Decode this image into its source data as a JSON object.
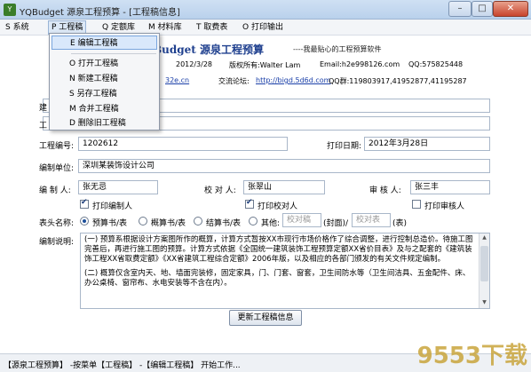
{
  "window": {
    "title": "YQBudget 源泉工程预算 - [工程稿信息]",
    "minimize_glyph": "–",
    "maximize_glyph": "□",
    "close_glyph": "✕"
  },
  "menubar": {
    "system": "S 系统",
    "project": "P 工程稿",
    "quota": "Q 定额库",
    "material": "M 材料库",
    "tables": "T 取费表",
    "print": "O 打印输出"
  },
  "dropdown": {
    "edit": "E 编辑工程稿",
    "open": "O 打开工程稿",
    "new": "N 新建工程稿",
    "saveas": "S 另存工程稿",
    "merge": "M 合并工程稿",
    "delete": "D 删除旧工程稿"
  },
  "banner": {
    "line1_name": "Budget  源泉工程预算",
    "line1_slogan": "----我最贴心的工程预算软件",
    "line2_date": "2012/3/28",
    "line2_copyright": "版权所有:Walter Lam",
    "line2_email": "Email:h2e998126.com",
    "line2_qq": "QQ:575825448",
    "line3_site": "32e.cn",
    "line3_forum_label": "交流论坛:",
    "line3_forum_url": "http://bigd.5d6d.com",
    "line3_qqgroup": "QQ群:119803917,41952877,41195287"
  },
  "form": {
    "project_no_label": "工程编号:",
    "project_no": "1202612",
    "print_date_label": "打印日期:",
    "print_date": "2012年3月28日",
    "unit_label": "编制单位:",
    "unit": "深圳某装饰设计公司",
    "editor_label": "编 制 人:",
    "editor": "张无忌",
    "checker_label": "校 对 人:",
    "checker": "张翠山",
    "reviewer_label": "审 核 人:",
    "reviewer": "张三丰",
    "print_editor": "打印编制人",
    "print_checker": "打印校对人",
    "print_reviewer": "打印审核人",
    "header_label": "表头名称:",
    "radio_budget": "预算书/表",
    "radio_estimate": "概算书/表",
    "radio_settlement": "结算书/表",
    "radio_other": "其他:",
    "other_placeholder": "校对稿",
    "cover_label": "(封面)/",
    "table_placeholder": "校对表",
    "table_label": "(表)",
    "notes_label": "编制说明:",
    "update_button": "更新工程稿信息"
  },
  "notes": {
    "para1": "(一) 预算系根据设计方案图所作的概算，计算方式暂按XX市现行市场价格作了综合调整，进行控制总造价。待施工图完善后，再进行施工图的预算。计算方式依据《全国统一建筑装饰工程预算定额XX省价目表》及与之配套的《建筑装饰工程XX省取费定额》《XX省建筑工程综合定额》2006年版，以及相应的各部门颁发的有关文件规定编制。",
    "para2": "(二) 概算仅含室内天、地、墙面完装修，固定家具，门、门套、窗套，卫生间防水等（卫生间洁具、五金配件、床、办公桌椅、窗帘布、水电安装等不含在内）。"
  },
  "status": {
    "text": "【源泉工程预算】 -按菜单【工程稿】 -【编辑工程稿】 开始工作..."
  },
  "watermark": {
    "text": "9553下载"
  }
}
